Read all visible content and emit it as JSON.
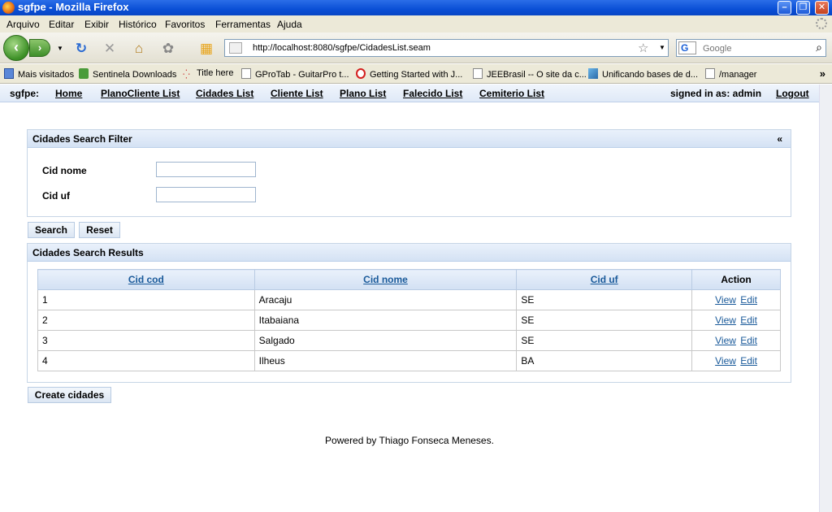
{
  "window": {
    "title": "sgfpe - Mozilla Firefox"
  },
  "menu": [
    "Arquivo",
    "Editar",
    "Exibir",
    "Histórico",
    "Favoritos",
    "Ferramentas",
    "Ajuda"
  ],
  "address": {
    "url": "http://localhost:8080/sgfpe/CidadesList.seam"
  },
  "search": {
    "engine": "G",
    "placeholder": "Google"
  },
  "bookmarks": [
    {
      "label": "Mais visitados",
      "icon": "most-visited-icon"
    },
    {
      "label": "Sentinela Downloads",
      "icon": "download-icon"
    },
    {
      "label": "Title here",
      "icon": "loading-icon"
    },
    {
      "label": "GProTab - GuitarPro t...",
      "icon": "page-icon"
    },
    {
      "label": "Getting Started with J...",
      "icon": "oracle-icon"
    },
    {
      "label": "JEEBrasil -- O site da c...",
      "icon": "page-icon"
    },
    {
      "label": "Unificando bases de d...",
      "icon": "cube-icon"
    },
    {
      "label": "/manager",
      "icon": "page-icon"
    }
  ],
  "app": {
    "brand": "sgfpe:",
    "nav": [
      "Home",
      "PlanoCliente List",
      "Cidades List",
      "Cliente List",
      "Plano List",
      "Falecido List",
      "Cemiterio List"
    ],
    "signed_in": "signed in as: admin",
    "logout": "Logout"
  },
  "filter": {
    "title": "Cidades Search Filter",
    "collapse": "«",
    "fields": [
      {
        "label": "Cid nome",
        "value": ""
      },
      {
        "label": "Cid uf",
        "value": ""
      }
    ],
    "search_label": "Search",
    "reset_label": "Reset"
  },
  "results": {
    "title": "Cidades Search Results",
    "columns": [
      "Cid cod",
      "Cid nome",
      "Cid uf",
      "Action"
    ],
    "rows": [
      {
        "cod": "1",
        "nome": "Aracaju",
        "uf": "SE"
      },
      {
        "cod": "2",
        "nome": "Itabaiana",
        "uf": "SE"
      },
      {
        "cod": "3",
        "nome": "Salgado",
        "uf": "SE"
      },
      {
        "cod": "4",
        "nome": "Ilheus",
        "uf": "BA"
      }
    ],
    "view_label": "View",
    "edit_label": "Edit"
  },
  "create_label": "Create cidades",
  "footer": "Powered by Thiago Fonseca Meneses."
}
